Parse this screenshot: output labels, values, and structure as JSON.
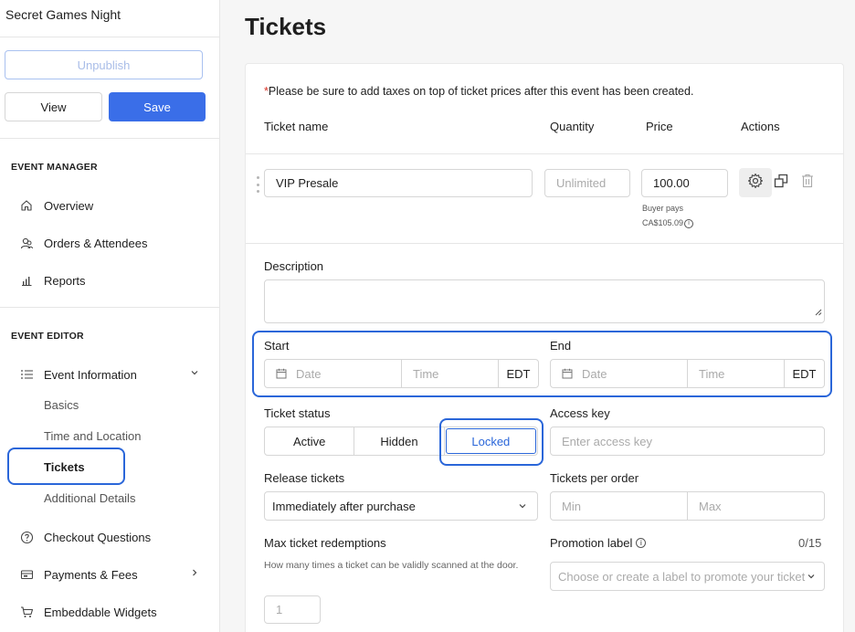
{
  "sidebar": {
    "event_name": "Secret Games Night",
    "unpublish_label": "Unpublish",
    "view_label": "View",
    "save_label": "Save",
    "event_manager_title": "EVENT MANAGER",
    "manager_items": [
      {
        "label": "Overview",
        "icon": "home-icon"
      },
      {
        "label": "Orders & Attendees",
        "icon": "people-icon"
      },
      {
        "label": "Reports",
        "icon": "bar-chart-icon"
      }
    ],
    "event_editor_title": "EVENT EDITOR",
    "event_information_label": "Event Information",
    "sub_items": [
      "Basics",
      "Time and Location",
      "Tickets",
      "Additional Details"
    ],
    "editor_items": [
      {
        "label": "Checkout Questions",
        "icon": "question-circle-icon"
      },
      {
        "label": "Payments & Fees",
        "icon": "payment-icon"
      },
      {
        "label": "Embeddable Widgets",
        "icon": "cart-icon"
      }
    ]
  },
  "main": {
    "title": "Tickets",
    "note_star": "*",
    "note": "Please be sure to add taxes on top of ticket prices after this event has been created.",
    "columns": {
      "name": "Ticket name",
      "quantity": "Quantity",
      "price": "Price",
      "actions": "Actions"
    },
    "ticket": {
      "name": "VIP Presale",
      "quantity_placeholder": "Unlimited",
      "price": "100.00",
      "buyer_pays_label": "Buyer pays",
      "buyer_pays_amount": "CA$105.09"
    },
    "description_label": "Description",
    "start": {
      "label": "Start",
      "date_placeholder": "Date",
      "time_placeholder": "Time",
      "timezone": "EDT"
    },
    "end": {
      "label": "End",
      "date_placeholder": "Date",
      "time_placeholder": "Time",
      "timezone": "EDT"
    },
    "ticket_status": {
      "label": "Ticket status",
      "options": [
        "Active",
        "Hidden",
        "Locked"
      ],
      "selected": "Locked"
    },
    "access_key": {
      "label": "Access key",
      "placeholder": "Enter access key"
    },
    "release": {
      "label": "Release tickets",
      "value": "Immediately after purchase"
    },
    "per_order": {
      "label": "Tickets per order",
      "min_placeholder": "Min",
      "max_placeholder": "Max"
    },
    "redemptions": {
      "label": "Max ticket redemptions",
      "helper": "How many times a ticket can be validly scanned at the door.",
      "value": "1"
    },
    "promotion": {
      "label": "Promotion label",
      "counter": "0/15",
      "placeholder": "Choose or create a label to promote your ticket"
    }
  },
  "colors": {
    "accent": "#3a6ee8",
    "highlight": "#2a66d9",
    "required": "#d93025"
  }
}
